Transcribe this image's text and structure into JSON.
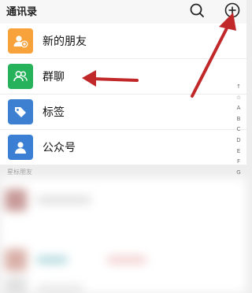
{
  "header": {
    "title": "通讯录",
    "search_icon": "search-icon",
    "add_icon": "add-circle-icon"
  },
  "menu": {
    "items": [
      {
        "label": "新的朋友",
        "icon": "add-friend-icon",
        "color": "#f7a23a"
      },
      {
        "label": "群聊",
        "icon": "group-chat-icon",
        "color": "#26b15b"
      },
      {
        "label": "标签",
        "icon": "tag-icon",
        "color": "#3d7fd0"
      },
      {
        "label": "公众号",
        "icon": "official-account-icon",
        "color": "#3a7fd4"
      }
    ]
  },
  "index_bar": [
    "↑",
    "☆",
    "A",
    "B",
    "C",
    "D",
    "E",
    "F",
    "G"
  ],
  "section": {
    "starred_label": "星标朋友"
  },
  "annotation": {
    "arrow_color": "#c0282a"
  }
}
